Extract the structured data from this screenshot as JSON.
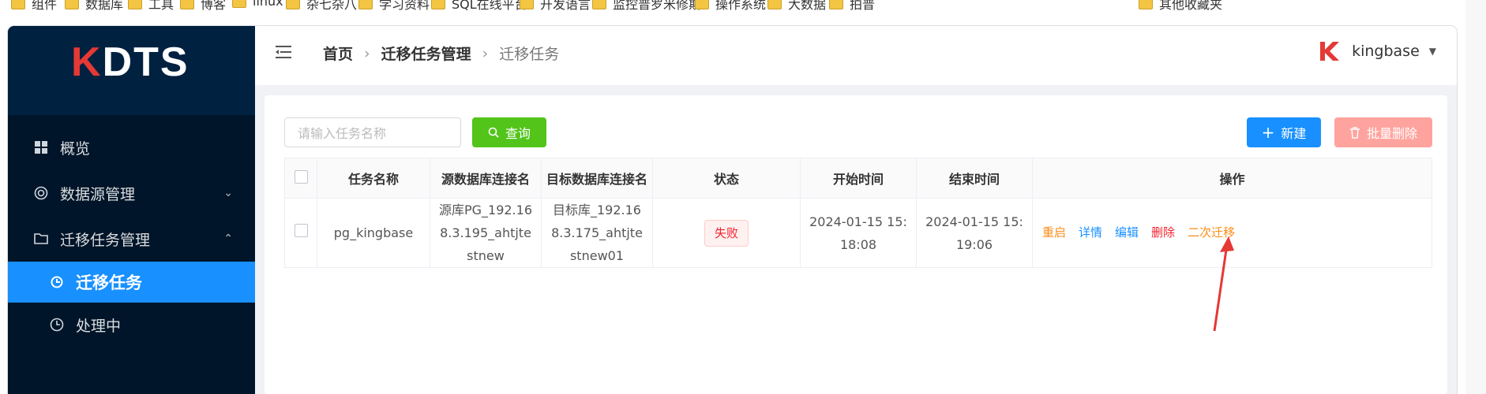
{
  "bookmarks": [
    "组件",
    "数据库",
    "工具",
    "博客",
    "linux",
    "杂七杂八",
    "学习资料",
    "SQL在线平台",
    "开发语言",
    "监控普罗米修斯",
    "操作系统",
    "大数据",
    "拍普",
    "其他收藏夹"
  ],
  "logo": {
    "k": "K",
    "rest": "DTS"
  },
  "sidebar": {
    "items": [
      {
        "label": "概览"
      },
      {
        "label": "数据源管理"
      },
      {
        "label": "迁移任务管理"
      },
      {
        "label": "迁移任务"
      },
      {
        "label": "处理中"
      }
    ]
  },
  "header": {
    "breadcrumb": [
      "首页",
      "迁移任务管理",
      "迁移任务"
    ],
    "user": "kingbase"
  },
  "toolbar": {
    "search_placeholder": "请输入任务名称",
    "query_label": "查询",
    "new_label": "新建",
    "batch_delete_label": "批量删除"
  },
  "table": {
    "columns": [
      "任务名称",
      "源数据库连接名",
      "目标数据库连接名",
      "状态",
      "开始时间",
      "结束时间",
      "操作"
    ],
    "rows": [
      {
        "name": "pg_kingbase",
        "source": "源库PG_192.168.3.195_ahtjtestnew",
        "target": "目标库_192.168.3.175_ahtjtestnew01",
        "status": "失败",
        "start": "2024-01-15 15:18:08",
        "end": "2024-01-15 15:19:06",
        "actions": [
          "重启",
          "详情",
          "编辑",
          "删除",
          "二次迁移"
        ]
      }
    ]
  },
  "colors": {
    "accent": "#1890ff",
    "success": "#52c41a",
    "danger": "#f5222d",
    "warning": "#fa8c16",
    "sidebar": "#001529"
  }
}
